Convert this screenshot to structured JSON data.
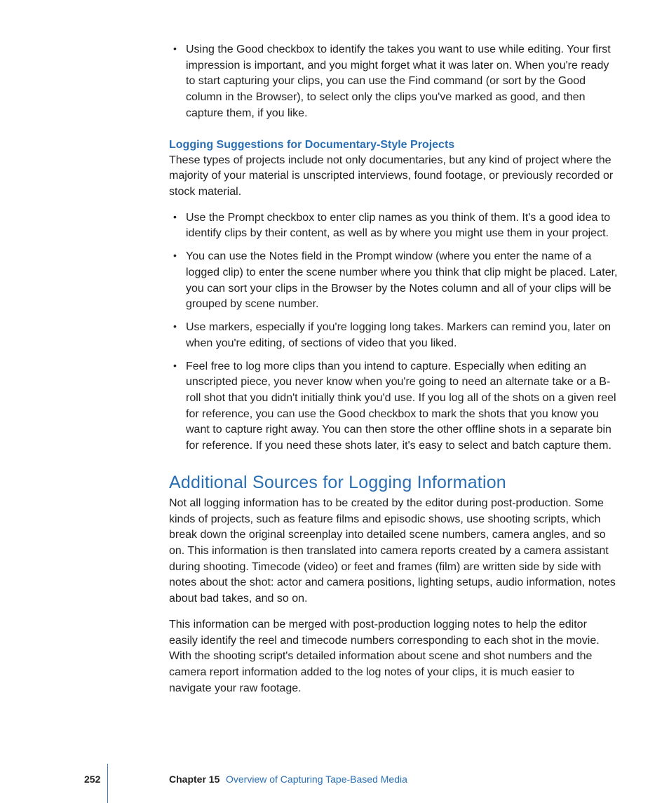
{
  "intro_bullets": [
    "Using the Good checkbox to identify the takes you want to use while editing. Your first impression is important, and you might forget what it was later on. When you're ready to start capturing your clips, you can use the Find command (or sort by the Good column in the Browser), to select only the clips you've marked as good, and then capture them, if you like."
  ],
  "doc_section": {
    "heading": "Logging Suggestions for Documentary-Style Projects",
    "intro": "These types of projects include not only documentaries, but any kind of project where the majority of your material is unscripted interviews, found footage, or previously recorded or stock material.",
    "bullets": [
      "Use the Prompt checkbox to enter clip names as you think of them. It's a good idea to identify clips by their content, as well as by where you might use them in your project.",
      "You can use the Notes field in the Prompt window (where you enter the name of a logged clip) to enter the scene number where you think that clip might be placed. Later, you can sort your clips in the Browser by the Notes column and all of your clips will be grouped by scene number.",
      "Use markers, especially if you're logging long takes. Markers can remind you, later on when you're editing, of sections of video that you liked.",
      "Feel free to log more clips than you intend to capture. Especially when editing an unscripted piece, you never know when you're going to need an alternate take or a B-roll shot that you didn't initially think you'd use. If you log all of the shots on a given reel for reference, you can use the Good checkbox to mark the shots that you know you want to capture right away. You can then store the other offline shots in a separate bin for reference. If you need these shots later, it's easy to select and batch capture them."
    ]
  },
  "additional": {
    "title": "Additional Sources for Logging Information",
    "p1": "Not all logging information has to be created by the editor during post-production. Some kinds of projects, such as feature films and episodic shows, use shooting scripts, which break down the original screenplay into detailed scene numbers, camera angles, and so on. This information is then translated into camera reports created by a camera assistant during shooting. Timecode (video) or feet and frames (film) are written side by side with notes about the shot: actor and camera positions, lighting setups, audio information, notes about bad takes, and so on.",
    "p2": "This information can be merged with post-production logging notes to help the editor easily identify the reel and timecode numbers corresponding to each shot in the movie. With the shooting script's detailed information about scene and shot numbers and the camera report information added to the log notes of your clips, it is much easier to navigate your raw footage."
  },
  "footer": {
    "page": "252",
    "chapter_label": "Chapter 15",
    "chapter_title": "Overview of Capturing Tape-Based Media"
  }
}
